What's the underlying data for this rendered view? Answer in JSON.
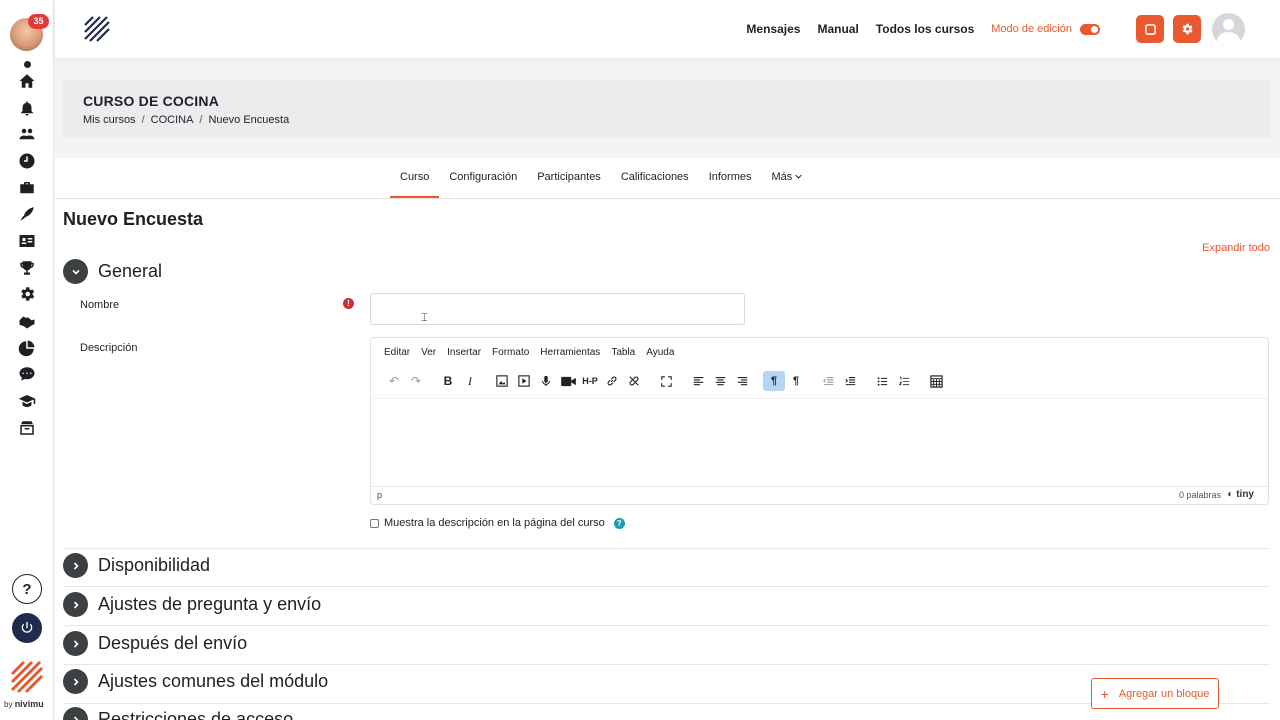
{
  "sidebar": {
    "notification_count": "35",
    "help_glyph": "?",
    "byline_by": "by",
    "byline_brand": "nivimu",
    "icons": [
      "home-icon",
      "bell-icon",
      "users-icon",
      "clock-icon",
      "briefcase-icon",
      "quill-icon",
      "id-card-icon",
      "trophy-icon",
      "gear-icon",
      "handshake-icon",
      "pie-chart-icon",
      "chat-icon",
      "graduation-cap-icon",
      "box-icon"
    ]
  },
  "navbar": {
    "links": [
      "Mensajes",
      "Manual",
      "Todos los cursos"
    ],
    "edit_mode_label": "Modo de edición"
  },
  "header": {
    "course_title": "CURSO DE COCINA",
    "breadcrumb": [
      "Mis cursos",
      "COCINA",
      "Nuevo Encuesta"
    ],
    "separator": "/"
  },
  "secondary_nav": {
    "items": [
      "Curso",
      "Configuración",
      "Participantes",
      "Calificaciones",
      "Informes",
      "Más"
    ],
    "active": "Curso"
  },
  "page": {
    "title": "Nuevo Encuesta",
    "expand_all": "Expandir todo"
  },
  "general": {
    "title": "General",
    "name_label": "Nombre",
    "name_value": "",
    "description_label": "Descripción",
    "required_glyph": "!",
    "show_description_label": "Muestra la descripción en la página del curso",
    "show_description_checked": false,
    "info_glyph": "?"
  },
  "editor": {
    "menu": [
      "Editar",
      "Ver",
      "Insertar",
      "Formato",
      "Herramientas",
      "Tabla",
      "Ayuda"
    ],
    "status_element": "p",
    "word_count": "0 palabras",
    "brand": "tiny"
  },
  "sections": [
    "Disponibilidad",
    "Ajustes de pregunta y envío",
    "Después del envío",
    "Ajustes comunes del módulo",
    "Restricciones de acceso"
  ],
  "footer": {
    "add_block_label": "Agregar un bloque",
    "add_block_glyph": "+"
  },
  "colors": {
    "accent": "#e8592f",
    "dark": "#1d2125"
  }
}
